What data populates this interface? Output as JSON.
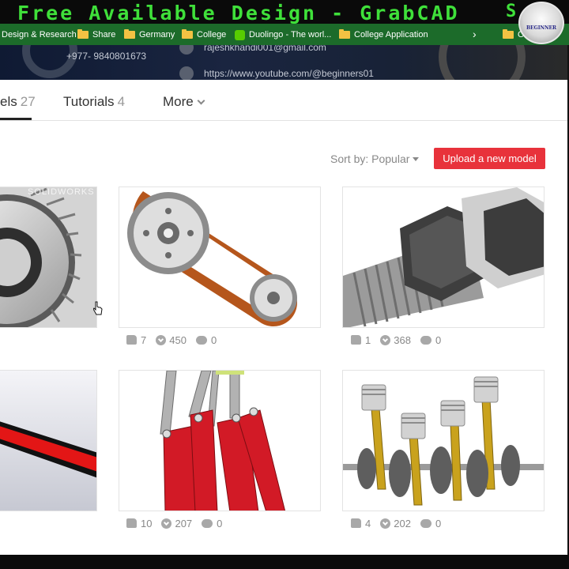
{
  "caption": {
    "text": "Free Available Design - GrabCAD",
    "tail": "S"
  },
  "bookmarks": [
    {
      "label": "Design & Research",
      "icon": "none"
    },
    {
      "label": "Share",
      "icon": "folder-icon"
    },
    {
      "label": "Germany",
      "icon": "folder-icon"
    },
    {
      "label": "College",
      "icon": "folder-icon"
    },
    {
      "label": "Duolingo - The worl...",
      "icon": "duolingo-icon"
    },
    {
      "label": "College Application",
      "icon": "folder-icon"
    },
    {
      "label": "Ot",
      "icon": "folder-icon"
    }
  ],
  "avatar": {
    "text": "BEGINNER"
  },
  "profile": {
    "phone": "+977- 9840801673",
    "email": "rajeshkhandi001@gmail.com",
    "youtube": "https://www.youtube.com/@beginners01"
  },
  "tabs": [
    {
      "label": "els",
      "count": "27",
      "active": true
    },
    {
      "label": "Tutorials",
      "count": "4",
      "active": false
    },
    {
      "label": "More",
      "count": "",
      "active": false
    }
  ],
  "sort": {
    "label": "Sort by: Popular"
  },
  "upload": {
    "label": "Upload a new model"
  },
  "cards": [
    {
      "model": "gear",
      "overlay": "SOLIDWORKS",
      "likes": "",
      "downloads": "",
      "comments": ""
    },
    {
      "model": "belt-pulley",
      "likes": "7",
      "downloads": "450",
      "comments": "0"
    },
    {
      "model": "bolt-nut",
      "likes": "1",
      "downloads": "368",
      "comments": "0"
    },
    {
      "model": "red-stripe",
      "likes": "",
      "downloads": "",
      "comments": ""
    },
    {
      "model": "linkage",
      "likes": "10",
      "downloads": "207",
      "comments": "0"
    },
    {
      "model": "crankshaft-pistons",
      "likes": "4",
      "downloads": "202",
      "comments": "0"
    }
  ],
  "colors": {
    "caption_text": "#3fe03a",
    "bookmarks_bg": "#1c6b2a",
    "upload_bg": "#e8323b"
  }
}
